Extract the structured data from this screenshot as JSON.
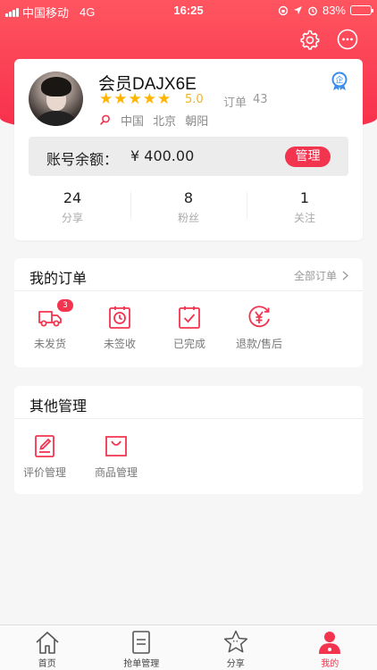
{
  "status_bar": {
    "carrier": "中国移动",
    "network": "4G",
    "time": "16:25",
    "battery": "83%",
    "battery_level": 0.83
  },
  "header": {
    "settings_icon": "gear-icon",
    "message_icon": "chat-bubble-icon"
  },
  "profile": {
    "name": "会员DAJX6E",
    "rating_stars": 5,
    "rating": "5.0",
    "order_label": "订单",
    "order_count": "43",
    "location": "中国 北京 朝阳",
    "balance_label": "账号余额：",
    "balance_value": "¥ 400.00",
    "manage_label": "管理",
    "stats": [
      {
        "value": "24",
        "label": "分享"
      },
      {
        "value": "8",
        "label": "粉丝"
      },
      {
        "value": "1",
        "label": "关注"
      }
    ]
  },
  "orders": {
    "title": "我的订单",
    "all_link": "全部订单",
    "items": [
      {
        "label": "未发货",
        "icon": "truck-icon",
        "badge": "3"
      },
      {
        "label": "未签收",
        "icon": "clock-clipboard-icon"
      },
      {
        "label": "已完成",
        "icon": "check-clipboard-icon"
      },
      {
        "label": "退款/售后",
        "icon": "yen-refund-icon"
      }
    ]
  },
  "other": {
    "title": "其他管理",
    "items": [
      {
        "label": "评价管理",
        "icon": "edit-note-icon"
      },
      {
        "label": "商品管理",
        "icon": "shopping-bag-icon"
      }
    ]
  },
  "tabbar": {
    "tabs": [
      {
        "label": "首页",
        "icon": "home-icon"
      },
      {
        "label": "抢单管理",
        "icon": "document-icon"
      },
      {
        "label": "分享",
        "icon": "star-icon"
      },
      {
        "label": "我的",
        "icon": "person-icon"
      }
    ],
    "active": "我的"
  },
  "colors": {
    "accent": "#f2344f",
    "header": "#ff4d5e",
    "star": "#ffb400"
  }
}
